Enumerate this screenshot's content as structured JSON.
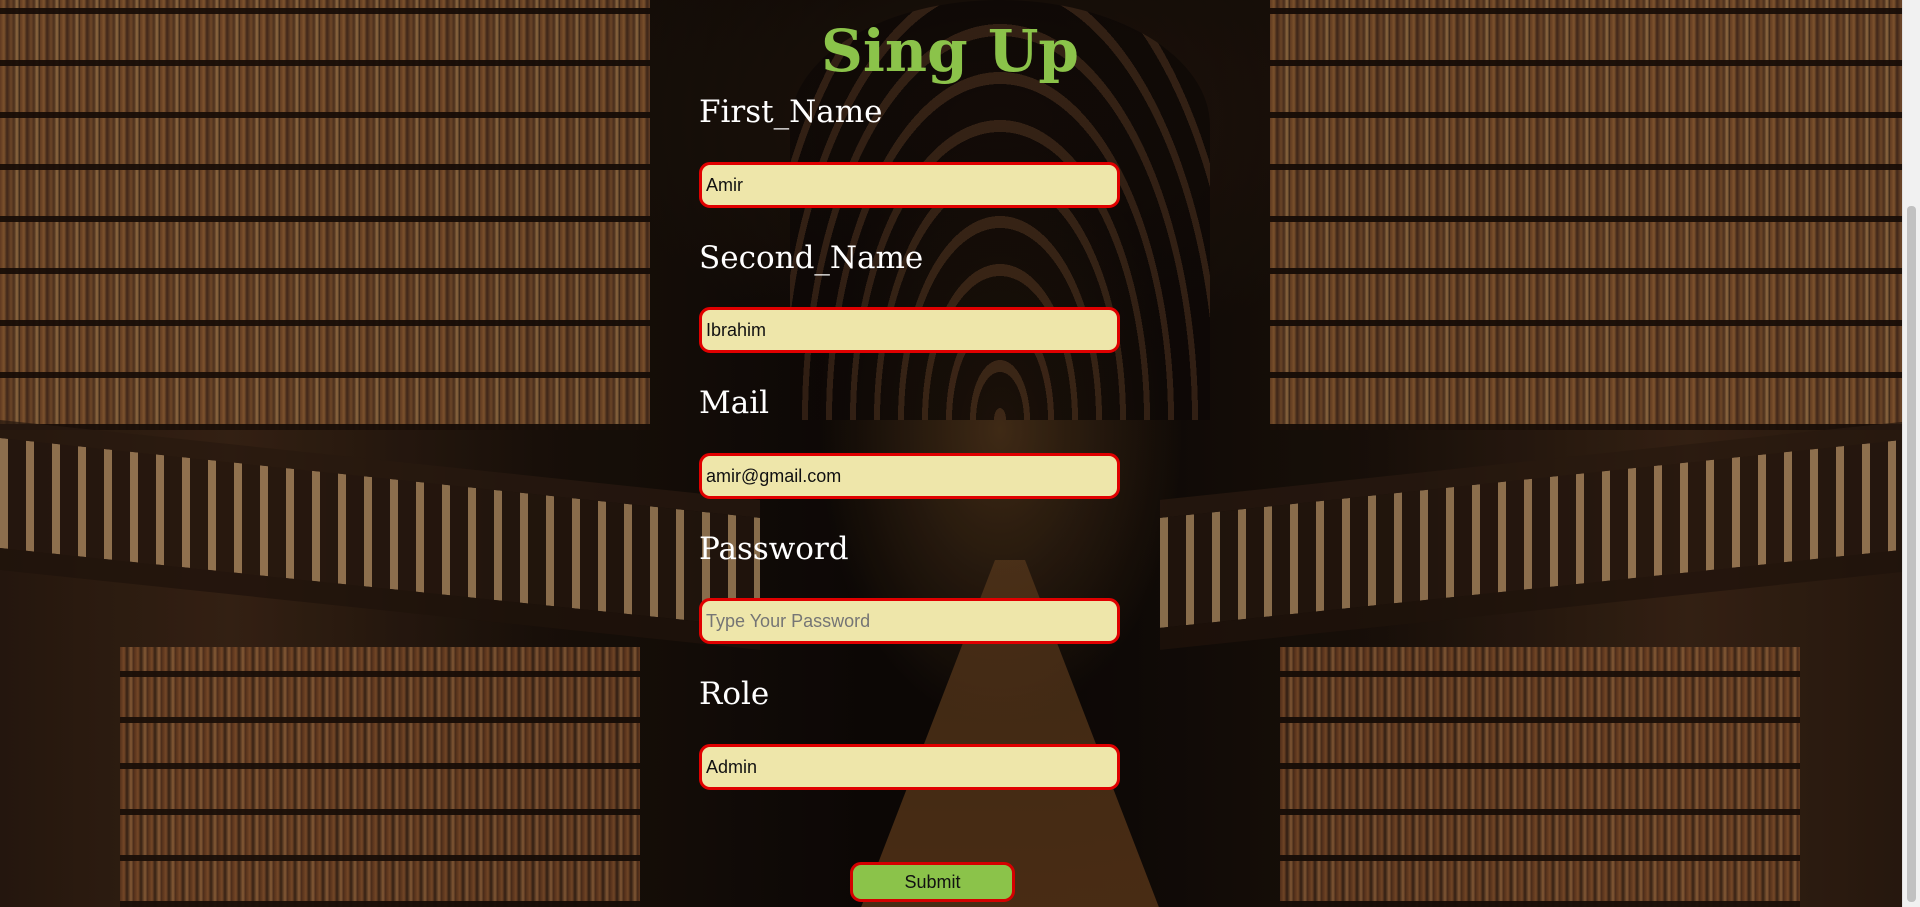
{
  "form": {
    "title": "Sing Up",
    "fields": [
      {
        "label": "First_Name",
        "value": "Amir",
        "placeholder": ""
      },
      {
        "label": "Second_Name",
        "value": "Ibrahim",
        "placeholder": ""
      },
      {
        "label": "Mail",
        "value": "amir@gmail.com",
        "placeholder": ""
      },
      {
        "label": "Password",
        "value": "",
        "placeholder": "Type Your Password"
      },
      {
        "label": "Role",
        "value": "Admin",
        "placeholder": ""
      }
    ],
    "submit_label": "Submit"
  },
  "colors": {
    "title": "#8bc34a",
    "input_background": "#eee6aa",
    "input_border": "#e00000",
    "button_background": "#8bc34a"
  }
}
